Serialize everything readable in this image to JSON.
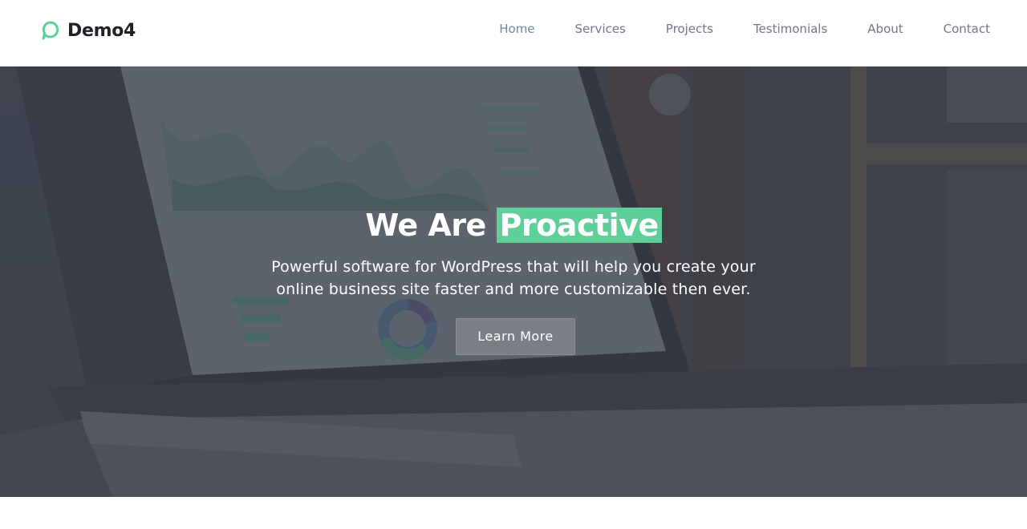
{
  "brand": {
    "name": "Demo4",
    "accent": "#5fcf9a"
  },
  "nav": {
    "items": [
      {
        "label": "Home",
        "active": true
      },
      {
        "label": "Services"
      },
      {
        "label": "Projects"
      },
      {
        "label": "Testimonials"
      },
      {
        "label": "About"
      },
      {
        "label": "Contact"
      }
    ]
  },
  "hero": {
    "title_prefix": "We Are",
    "title_highlight": "Proactive",
    "subtitle_line1": "Powerful software for WordPress that will help you create your",
    "subtitle_line2": "online business site faster and more customizable then ever.",
    "cta_label": "Learn More",
    "background_image": "laptop with analytics dashboard"
  }
}
